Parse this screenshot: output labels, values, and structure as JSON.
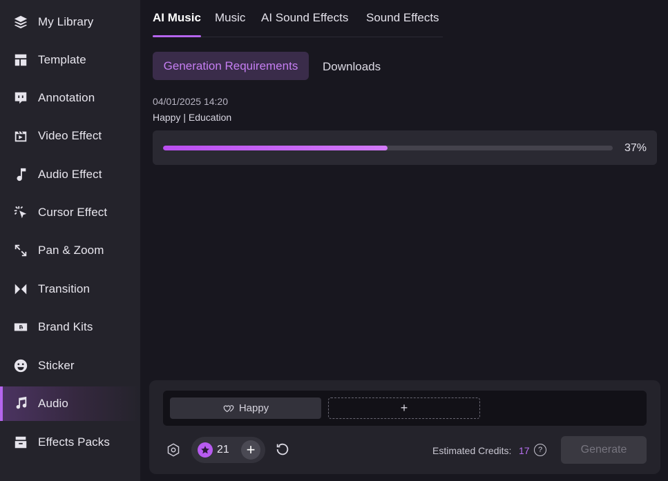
{
  "sidebar": {
    "items": [
      {
        "label": "My Library",
        "icon": "layers-icon"
      },
      {
        "label": "Template",
        "icon": "template-icon"
      },
      {
        "label": "Annotation",
        "icon": "annotation-icon"
      },
      {
        "label": "Video Effect",
        "icon": "video-effect-icon"
      },
      {
        "label": "Audio Effect",
        "icon": "audio-effect-icon"
      },
      {
        "label": "Cursor Effect",
        "icon": "cursor-effect-icon"
      },
      {
        "label": "Pan & Zoom",
        "icon": "pan-zoom-icon"
      },
      {
        "label": "Transition",
        "icon": "transition-icon"
      },
      {
        "label": "Brand Kits",
        "icon": "brand-kits-icon"
      },
      {
        "label": "Sticker",
        "icon": "sticker-icon"
      },
      {
        "label": "Audio",
        "icon": "music-note-icon",
        "active": true
      },
      {
        "label": "Effects Packs",
        "icon": "effects-pack-icon"
      }
    ]
  },
  "tabs": {
    "items": [
      "AI Music",
      "Music",
      "AI Sound Effects",
      "Sound Effects"
    ],
    "active": "AI Music"
  },
  "subtabs": {
    "active_label": "Generation Requirements",
    "other_label": "Downloads"
  },
  "job": {
    "datetime": "04/01/2025 14:20",
    "tags": "Happy | Education",
    "progress_percent": 37,
    "progress_label": "37%"
  },
  "bottom": {
    "tag_chip": "Happy",
    "add_label": "+",
    "count": "21",
    "plus_label": "+",
    "credits_label": "Estimated Credits:",
    "credits_value": "17",
    "help_label": "?",
    "generate_label": "Generate"
  },
  "colors": {
    "accent": "#b565ee",
    "background": "#18171f",
    "sidebar": "#24232b"
  }
}
